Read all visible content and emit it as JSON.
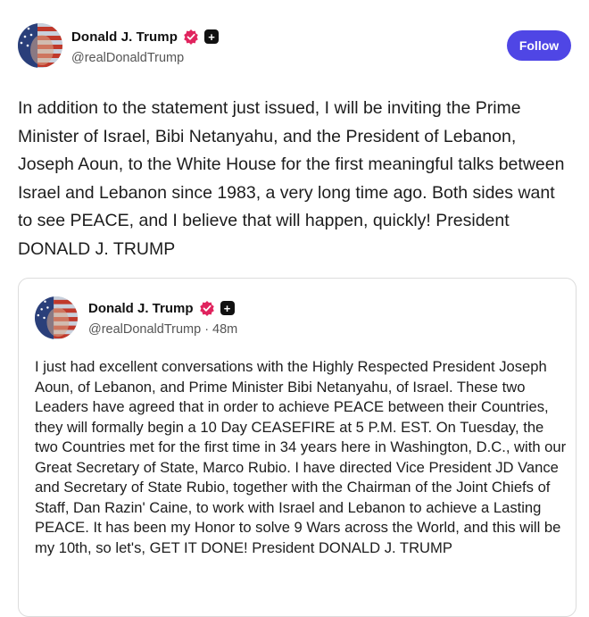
{
  "post": {
    "author": {
      "name": "Donald J. Trump",
      "handle": "@realDonaldTrump",
      "plus_symbol": "+"
    },
    "follow_label": "Follow",
    "text": "In addition to the statement just issued, I will be inviting the Prime Minister of Israel, Bibi Netanyahu, and the President of Lebanon, Joseph Aoun, to the White House for the first meaningful talks between Israel and Lebanon since 1983, a very long time ago. Both sides want to see PEACE, and I believe that will happen, quickly! President DONALD J. TRUMP"
  },
  "quoted_post": {
    "author": {
      "name": "Donald J. Trump",
      "handle": "@realDonaldTrump",
      "plus_symbol": "+"
    },
    "separator": "·",
    "time": "48m",
    "text": "I just had excellent conversations with the Highly Respected President Joseph Aoun, of Lebanon, and Prime Minister Bibi Netanyahu, of Israel. These two Leaders have agreed that in order to achieve PEACE between their Countries, they will formally begin a 10 Day CEASEFIRE at 5 P.M. EST. On Tuesday, the two Countries met for the first time in 34 years here in Washington, D.C., with our Great Secretary of State, Marco Rubio. I have directed Vice President JD Vance and Secretary of State Rubio, together with the Chairman of the Joint Chiefs of Staff, Dan Razin' Caine, to work with Israel and Lebanon to achieve a Lasting PEACE. It has been my Honor to solve 9 Wars across the World, and this will be my 10th, so let's, GET IT DONE! President DONALD J. TRUMP"
  },
  "colors": {
    "follow_button": "#4f46e5",
    "verified_badge": "#e0245e",
    "text": "#1d1d1d",
    "secondary_text": "#555555"
  },
  "icons": {
    "verified": "verified-badge-icon",
    "plus": "plus-badge-icon",
    "avatar": "flag-avatar"
  }
}
